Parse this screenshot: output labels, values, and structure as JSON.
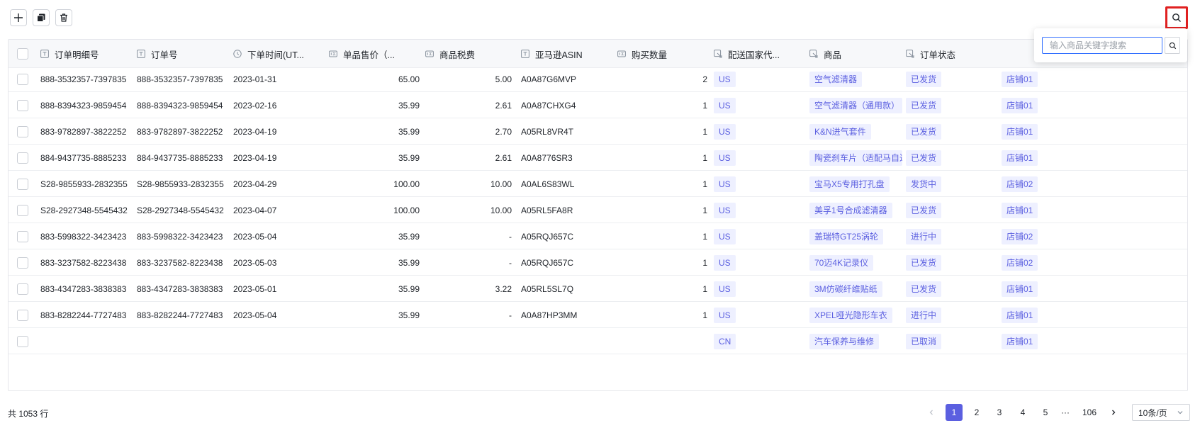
{
  "toolbar": {
    "add_icon": "plus-icon",
    "copy_icon": "copy-icon",
    "delete_icon": "trash-icon"
  },
  "search": {
    "placeholder": "输入商品关键字搜索",
    "toggle_icon": "search-icon"
  },
  "table": {
    "columns": [
      {
        "label": "订单明细号",
        "icon": "text-field-icon"
      },
      {
        "label": "订单号",
        "icon": "text-field-icon"
      },
      {
        "label": "下单时间(UT...",
        "icon": "clock-field-icon"
      },
      {
        "label": "单品售价（...",
        "icon": "number-field-icon"
      },
      {
        "label": "商品税费",
        "icon": "number-field-icon"
      },
      {
        "label": "亚马逊ASIN",
        "icon": "text-field-icon"
      },
      {
        "label": "购买数量",
        "icon": "number-field-icon"
      },
      {
        "label": "配送国家代...",
        "icon": "link-field-icon"
      },
      {
        "label": "商品",
        "icon": "link-field-icon"
      },
      {
        "label": "订单状态",
        "icon": "link-field-icon"
      }
    ],
    "rows": [
      {
        "detail": "888-3532357-7397835",
        "order": "888-3532357-7397835",
        "date": "2023-01-31",
        "price": "65.00",
        "tax": "5.00",
        "asin": "A0A87G6MVP",
        "qty": "2",
        "country": "US",
        "product": "空气滤清器",
        "status": "已发货",
        "store": "店铺01"
      },
      {
        "detail": "888-8394323-9859454",
        "order": "888-8394323-9859454",
        "date": "2023-02-16",
        "price": "35.99",
        "tax": "2.61",
        "asin": "A0A87CHXG4",
        "qty": "1",
        "country": "US",
        "product": "空气滤清器（通用款）",
        "status": "已发货",
        "store": "店铺01"
      },
      {
        "detail": "883-9782897-3822252",
        "order": "883-9782897-3822252",
        "date": "2023-04-19",
        "price": "35.99",
        "tax": "2.70",
        "asin": "A05RL8VR4T",
        "qty": "1",
        "country": "US",
        "product": "K&N进气套件",
        "status": "已发货",
        "store": "店铺01"
      },
      {
        "detail": "884-9437735-8885233",
        "order": "884-9437735-8885233",
        "date": "2023-04-19",
        "price": "35.99",
        "tax": "2.61",
        "asin": "A0A8776SR3",
        "qty": "1",
        "country": "US",
        "product": "陶瓷刹车片（适配马自达",
        "status": "已发货",
        "store": "店铺01"
      },
      {
        "detail": "S28-9855933-2832355",
        "order": "S28-9855933-2832355",
        "date": "2023-04-29",
        "price": "100.00",
        "tax": "10.00",
        "asin": "A0AL6S83WL",
        "qty": "1",
        "country": "US",
        "product": "宝马X5专用打孔盘",
        "status": "发货中",
        "store": "店铺02"
      },
      {
        "detail": "S28-2927348-5545432",
        "order": "S28-2927348-5545432",
        "date": "2023-04-07",
        "price": "100.00",
        "tax": "10.00",
        "asin": "A05RL5FA8R",
        "qty": "1",
        "country": "US",
        "product": "美孚1号合成滤清器",
        "status": "已发货",
        "store": "店铺01"
      },
      {
        "detail": "883-5998322-3423423",
        "order": "883-5998322-3423423",
        "date": "2023-05-04",
        "price": "35.99",
        "tax": "-",
        "asin": "A05RQJ657C",
        "qty": "1",
        "country": "US",
        "product": "盖瑞特GT25涡轮",
        "status": "进行中",
        "store": "店铺02"
      },
      {
        "detail": "883-3237582-8223438",
        "order": "883-3237582-8223438",
        "date": "2023-05-03",
        "price": "35.99",
        "tax": "-",
        "asin": "A05RQJ657C",
        "qty": "1",
        "country": "US",
        "product": "70迈4K记录仪",
        "status": "已发货",
        "store": "店铺02"
      },
      {
        "detail": "883-4347283-3838383",
        "order": "883-4347283-3838383",
        "date": "2023-05-01",
        "price": "35.99",
        "tax": "3.22",
        "asin": "A05RL5SL7Q",
        "qty": "1",
        "country": "US",
        "product": "3M仿碳纤维贴纸",
        "status": "已发货",
        "store": "店铺01"
      },
      {
        "detail": "883-8282244-7727483",
        "order": "883-8282244-7727483",
        "date": "2023-05-04",
        "price": "35.99",
        "tax": "-",
        "asin": "A0A87HP3MM",
        "qty": "1",
        "country": "US",
        "product": "XPEL哑光隐形车衣",
        "status": "进行中",
        "store": "店铺01"
      },
      {
        "detail": "",
        "order": "",
        "date": "",
        "price": "",
        "tax": "",
        "asin": "",
        "qty": "",
        "country": "CN",
        "product": "汽车保养与维修",
        "status": "已取消",
        "store": "店铺01"
      }
    ]
  },
  "footer": {
    "total": "共 1053 行",
    "pages": [
      "1",
      "2",
      "3",
      "4",
      "5"
    ],
    "ellipsis": "···",
    "last_page": "106",
    "active_page": "1",
    "page_size": "10条/页"
  },
  "colors": {
    "accent": "#5b5fe0",
    "tag_bg": "#eef0ff",
    "highlight_border": "#e02020"
  }
}
